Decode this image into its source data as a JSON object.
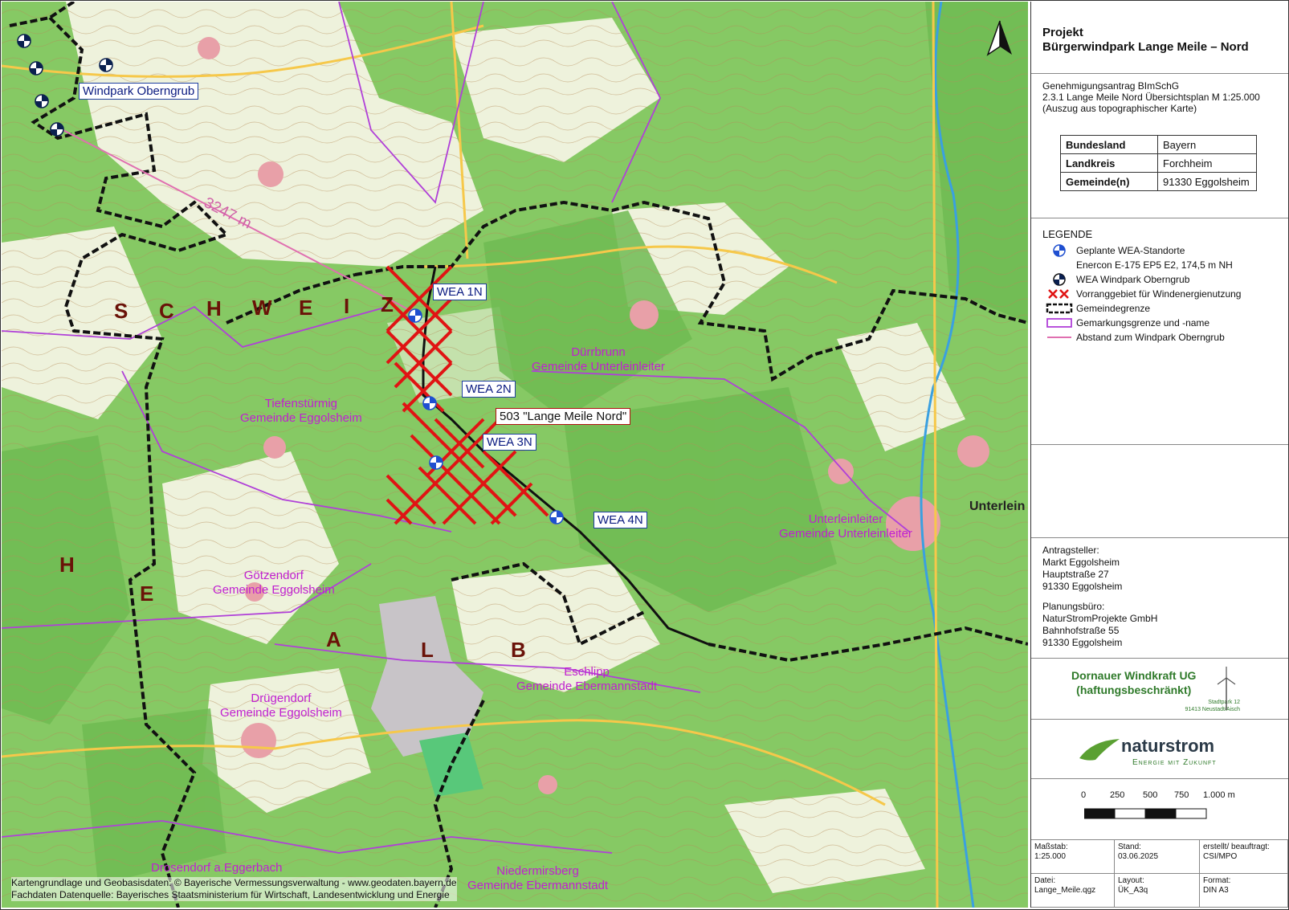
{
  "map": {
    "turbine_labels": [
      "WEA 1N",
      "WEA 2N",
      "WEA 3N",
      "WEA 4N"
    ],
    "windpark_label": "Windpark Oberngrub",
    "area_label": "503 \"Lange Meile Nord\"",
    "distance_label": "3247 m",
    "region_letters": [
      "S",
      "C",
      "H",
      "W",
      "E",
      "I",
      "Z",
      "H",
      "E",
      "A",
      "L",
      "B"
    ],
    "places": [
      {
        "name": "Dürrbrunn",
        "gemeinde": "Gemeinde Unterleinleiter"
      },
      {
        "name": "Tiefenstürmig",
        "gemeinde": "Gemeinde Eggolsheim"
      },
      {
        "name": "Götzendorf",
        "gemeinde": "Gemeinde Eggolsheim"
      },
      {
        "name": "Drügendorf",
        "gemeinde": "Gemeinde Eggolsheim"
      },
      {
        "name": "Unterleinleiter",
        "gemeinde": "Gemeinde Unterleinleiter"
      },
      {
        "name": "Eschlipp",
        "gemeinde": "Gemeinde Ebermannstadt"
      },
      {
        "name": "Niedermirsberg",
        "gemeinde": "Gemeinde Ebermannstadt"
      },
      {
        "name": "Drosendorf a.Eggerbach",
        "gemeinde": ""
      }
    ],
    "town_big": "Unterlein",
    "credits": [
      "Kartengrundlage und Geobasisdaten: © Bayerische Vermessungsverwaltung - www.geodaten.bayern.de",
      "Fachdaten Datenquelle: Bayerisches Staatsministerium für Wirtschaft, Landesentwicklung und Energie"
    ],
    "colors": {
      "forest": "#7cc65a",
      "field": "#eef3dc",
      "red_hatch": "#e01414",
      "boundary": "#111111",
      "district": "#b040d8",
      "distance": "#e070b0"
    }
  },
  "panel": {
    "project_title": [
      "Projekt",
      "Bürgerwindpark Lange Meile – Nord"
    ],
    "subtitle": [
      "Genehmigungsantrag BImSchG",
      "2.3.1 Lange Meile Nord Übersichtsplan M 1:25.000",
      "(Auszug aus topographischer Karte)"
    ],
    "admin": [
      {
        "k": "Bundesland",
        "v": "Bayern"
      },
      {
        "k": "Landkreis",
        "v": "Forchheim"
      },
      {
        "k": "Gemeinde(n)",
        "v": "91330 Eggolsheim"
      }
    ],
    "legend_title": "LEGENDE",
    "legend": [
      {
        "icon": "planned-turbine",
        "text": "Geplante WEA-Standorte"
      },
      {
        "icon": "none",
        "text": "Enercon E-175 EP5 E2, 174,5 m NH"
      },
      {
        "icon": "existing-turbine",
        "text": "WEA Windpark Oberngrub"
      },
      {
        "icon": "hatch",
        "text": "Vorranggebiet für Windenergienutzung"
      },
      {
        "icon": "boundary",
        "text": "Gemeindegrenze"
      },
      {
        "icon": "district",
        "text": "Gemarkungsgrenze und -name"
      },
      {
        "icon": "distance",
        "text": "Abstand zum Windpark Oberngrub"
      }
    ],
    "applicant": [
      "Antragsteller:",
      "Markt Eggolsheim",
      "Hauptstraße 27",
      "91330 Eggolsheim"
    ],
    "planner": [
      "Planungsbüro:",
      "NaturStromProjekte GmbH",
      "Bahnhofstraße 55",
      "91330 Eggolsheim"
    ],
    "logo1": {
      "line1": "Dornauer Windkraft UG",
      "line2": "(haftungsbeschränkt)",
      "line3": "Stadtpark 12",
      "line4": "91413 Neustadt/Aisch"
    },
    "logo2": {
      "word_a": "natur",
      "word_b": "strom",
      "tagline": "Energie mit Zukunft"
    },
    "scale_ticks": [
      "0",
      "250",
      "500",
      "750",
      "1.000 m"
    ],
    "footer": [
      {
        "label": "Maßstab:",
        "value": "1:25.000"
      },
      {
        "label": "Stand:",
        "value": "03.06.2025"
      },
      {
        "label": "erstellt/ beauftragt:",
        "value": "CSI/MPO"
      },
      {
        "label": "Datei:",
        "value": "Lange_Meile.qgz"
      },
      {
        "label": "Layout:",
        "value": "ÜK_A3q"
      },
      {
        "label": "Format:",
        "value": "DIN A3"
      }
    ]
  }
}
